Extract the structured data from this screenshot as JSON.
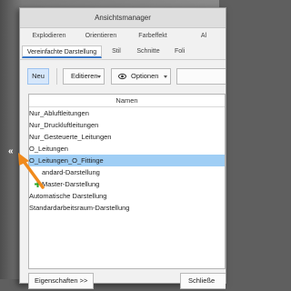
{
  "dialog": {
    "title": "Ansichtsmanager"
  },
  "tabs_row1": [
    "Explodieren",
    "Orientieren",
    "Farbeffekt",
    "Al"
  ],
  "tabs_row2": [
    "Vereinfachte Darstellung",
    "Stil",
    "Schnitte",
    "Foli"
  ],
  "toolbar": {
    "new_label": "Neu",
    "edit_label": "Editieren",
    "options_label": "Optionen"
  },
  "list": {
    "column_header": "Namen",
    "items": [
      "Nur_Abluftleitungen",
      "Nur_Druckluftleitungen",
      "Nur_Gesteuerte_Leitungen",
      "O_Leitungen",
      "O_Leitungen_O_Fittinge",
      "andard-Darstellung",
      "Master-Darstellung",
      "Automatische Darstellung",
      "Standardarbeitsraum-Darstellung"
    ],
    "selected_index": 4
  },
  "footer": {
    "properties_label": "Eigenschaften >>",
    "close_label": "Schließe"
  },
  "side": {
    "collapse_glyph": "«"
  },
  "colors": {
    "selection": "#9fcef5",
    "accent": "#3a78c8",
    "arrow": "#f08a1c",
    "plus": "#2aa52a"
  }
}
